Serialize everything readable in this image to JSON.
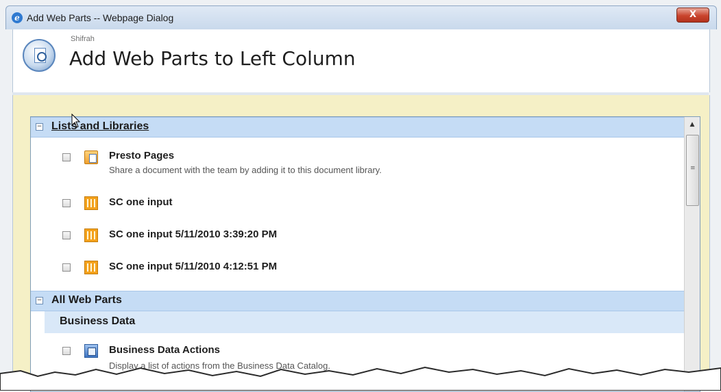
{
  "window": {
    "title": "Add Web Parts -- Webpage Dialog",
    "close_glyph": "X"
  },
  "header": {
    "site_name": "Shifrah",
    "title": "Add Web Parts to Left Column"
  },
  "groups": [
    {
      "label": "Lists and Libraries",
      "expanded": true,
      "items": [
        {
          "title": "Presto Pages",
          "description": "Share a document with the team by adding it to this document library.",
          "icon": "document-library-icon"
        },
        {
          "title": "SC one input",
          "description": "",
          "icon": "list-icon"
        },
        {
          "title": "SC one input 5/11/2010 3:39:20 PM",
          "description": "",
          "icon": "list-icon"
        },
        {
          "title": "SC one input 5/11/2010 4:12:51 PM",
          "description": "",
          "icon": "list-icon"
        }
      ]
    },
    {
      "label": "All Web Parts",
      "expanded": true,
      "subgroups": [
        {
          "label": "Business Data",
          "items": [
            {
              "title": "Business Data Actions",
              "description": "Display a list of actions from the Business Data Catalog.",
              "icon": "business-data-icon"
            }
          ]
        }
      ]
    }
  ],
  "colors": {
    "group_header": "#c5dcf5",
    "subgroup_header": "#d9e8f8",
    "workspace": "#f5f0c6",
    "close_button": "#c9442d"
  }
}
